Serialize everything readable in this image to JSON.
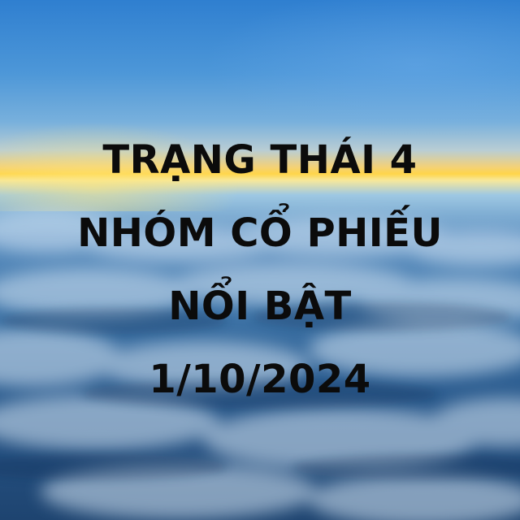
{
  "headline": {
    "line1": "TRẠNG THÁI 4",
    "line2": "NHÓM CỔ PHIẾU",
    "line3": "NỔI BẬT",
    "line4": "1/10/2024"
  },
  "colors": {
    "text": "#0b0b0b",
    "sky_top": "#2f7fd0",
    "horizon_glow": "#ffd54a",
    "clouds_dark": "#1e4470"
  }
}
